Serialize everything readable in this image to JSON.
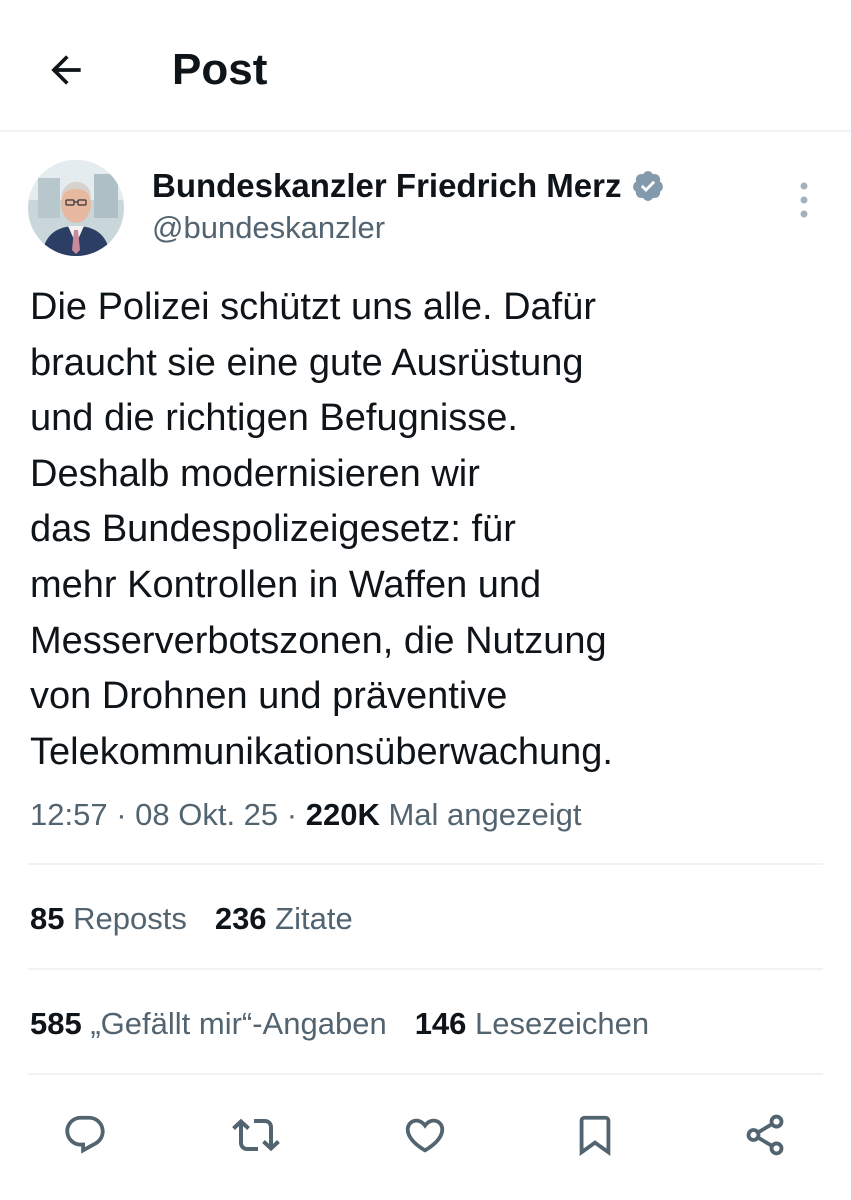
{
  "header": {
    "title": "Post"
  },
  "author": {
    "name": "Bundeskanzler Friedrich Merz",
    "handle": "@bundeskanzler"
  },
  "tweet": {
    "lines": [
      "Die Polizei schützt uns alle. Dafür",
      "braucht sie eine gute Ausrüstung",
      "und die richtigen Befugnisse.",
      "Deshalb modernisieren wir",
      "das Bundespolizeigesetz: für",
      "mehr Kontrollen in Waffen und",
      "Messerverbotszonen, die Nutzung"
    ],
    "line8_prefix": "von Drohnen und ",
    "line8_highlight": "präventive",
    "line9_highlight": "Telekommunikationsüberwachung."
  },
  "meta": {
    "time": "12:57",
    "sep1": " · ",
    "date": "08 Okt. 25",
    "sep2": " · ",
    "views": "220K",
    "views_label": " Mal angezeigt"
  },
  "stats": {
    "reposts": "85",
    "reposts_label": " Reposts",
    "quotes": "236",
    "quotes_label": " Zitate",
    "likes": "585",
    "likes_label": " „Gefällt mir“-Angaben",
    "bookmarks": "146",
    "bookmarks_label": " Lesezeichen"
  },
  "icons": {
    "back": "arrow-left-icon",
    "verified": "verified-badge-icon",
    "more": "more-vertical-icon",
    "reply": "reply-icon",
    "repost": "repost-icon",
    "like": "heart-icon",
    "bookmark": "bookmark-icon",
    "share": "share-icon"
  },
  "colors": {
    "text": "#0f1419",
    "secondary": "#536471",
    "divider": "#eff3f4",
    "verified": "#829aab",
    "highlight": "#f5f53c"
  }
}
